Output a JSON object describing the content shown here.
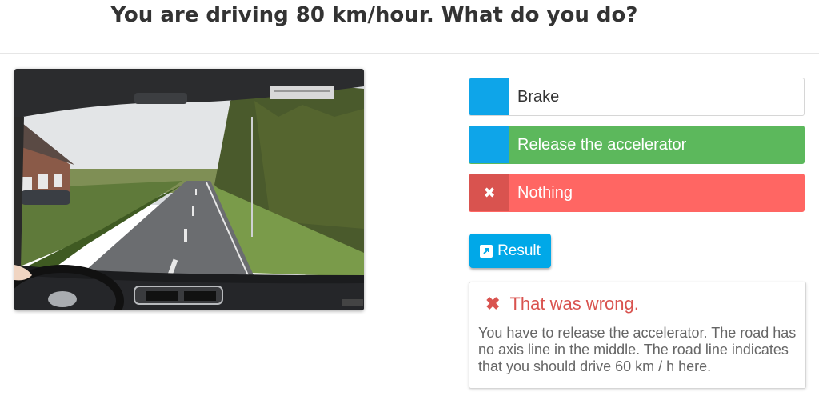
{
  "question": {
    "title": "You are driving 80 km/hour. What do you do?"
  },
  "answers": [
    {
      "label": "Brake",
      "state": "neutral",
      "marker": ""
    },
    {
      "label": "Release the accelerator",
      "state": "correct",
      "marker": ""
    },
    {
      "label": "Nothing",
      "state": "wrong",
      "marker": "✖"
    }
  ],
  "result_button": {
    "label": "Result",
    "icon": "external-link-icon"
  },
  "feedback": {
    "heading": "That was wrong.",
    "icon": "✖",
    "text": "You have to release the accelerator. The road has no axis line in the middle. The road line indicates that you should drive 60 km / h here."
  },
  "colors": {
    "accent_blue": "#0ea5e9",
    "correct_green": "#5cb85c",
    "wrong_red": "#ff6663",
    "wrong_marker": "#d9534f",
    "button_blue": "#00a8e8"
  }
}
